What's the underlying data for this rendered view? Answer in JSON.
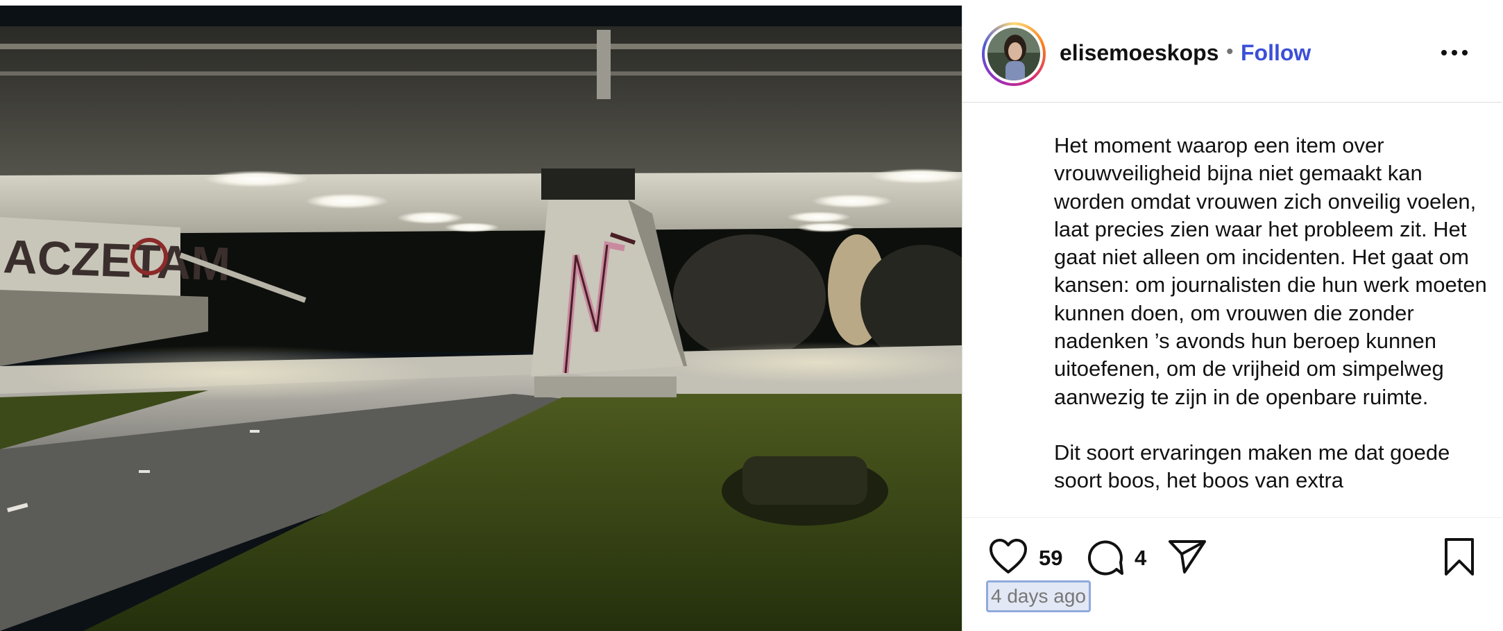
{
  "post": {
    "username": "elisemoeskops",
    "separator": "•",
    "follow_label": "Follow",
    "more_label": "More options",
    "photo_alt": "Fietstunnel onder een viaduct bij nacht",
    "graffiti_text": "ACZETAM",
    "caption_paragraphs": [
      "Het moment waarop een item over vrouwveiligheid bijna niet gemaakt kan worden omdat vrouwen zich onveilig voelen, laat precies zien waar het probleem zit. Het gaat niet alleen om incidenten. Het gaat om kansen: om journalisten die hun werk moeten kunnen doen, om vrouwen die zonder nadenken ’s avonds hun beroep kunnen uitoefenen, om de vrijheid om simpelweg aanwezig te zijn in de openbare ruimte.",
      "Dit soort ervaringen maken me dat goede soort boos, het boos van extra"
    ],
    "likes": "59",
    "comments": "4",
    "timestamp": "4 days ago"
  },
  "icons": {
    "like": "heart-icon",
    "comment": "comment-icon",
    "share": "share-icon",
    "save": "bookmark-icon",
    "more": "ellipsis-icon"
  },
  "colors": {
    "follow": "#3b4fd8",
    "text": "#111111",
    "muted": "#737373",
    "divider": "#dbdbdb",
    "timestamp_highlight": "#8fa9dd"
  }
}
